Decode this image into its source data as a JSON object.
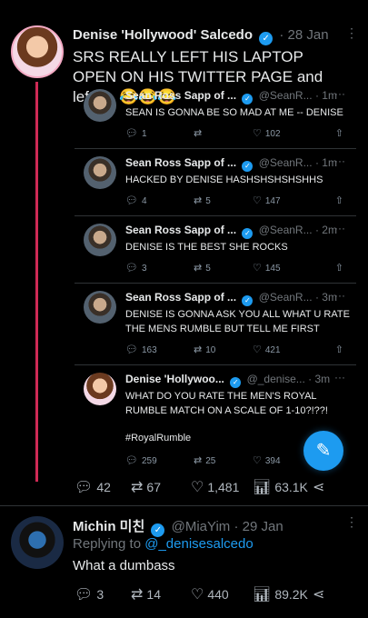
{
  "main_tweet": {
    "name": "Denise 'Hollywood' Salcedo",
    "time": "· 28 Jan",
    "text": "SRS REALLY LEFT HIS LAPTOP OPEN ON HIS TWITTER PAGE and left .... 😂😂😂",
    "stats": {
      "replies": "42",
      "retweets": "67",
      "likes": "1,481",
      "views": "63.1K"
    }
  },
  "quoted": [
    {
      "name": "Sean Ross Sapp of ...",
      "handle": "@SeanR...",
      "time": "· 1m",
      "text": "SEAN IS GONNA BE SO MAD AT ME -- DENISE",
      "replies": "1",
      "retweets": "",
      "likes": "102"
    },
    {
      "name": "Sean Ross Sapp of ...",
      "handle": "@SeanR...",
      "time": "· 1m",
      "text": "HACKED  BY DENISE HASHSHSHSHSHHS",
      "replies": "4",
      "retweets": "5",
      "likes": "147"
    },
    {
      "name": "Sean Ross Sapp of ...",
      "handle": "@SeanR...",
      "time": "· 2m",
      "text": "DENISE IS THE BEST SHE ROCKS",
      "replies": "3",
      "retweets": "5",
      "likes": "145"
    },
    {
      "name": "Sean Ross Sapp of ...",
      "handle": "@SeanR...",
      "time": "· 3m",
      "text": "DENISE IS GONNA ASK YOU ALL WHAT U RATE THE MENS RUMBLE BUT TELL ME FIRST",
      "replies": "163",
      "retweets": "10",
      "likes": "421"
    },
    {
      "name": "Denise 'Hollywoo...",
      "handle": "@_denise...",
      "time": "· 3m",
      "text": "WHAT DO YOU RATE THE MEN'S ROYAL RUMBLE MATCH ON A SCALE OF 1-10?!??!",
      "hashtag": "#RoyalRumble",
      "replies": "259",
      "retweets": "25",
      "likes": "394"
    }
  ],
  "reply_tweet": {
    "name": "Michin 미친",
    "handle": "@MiaYim",
    "time": "· 29 Jan",
    "replying_label": "Replying to",
    "replying_handle": "@_denisesalcedo",
    "text": "What a dumbass",
    "stats": {
      "replies": "3",
      "retweets": "14",
      "likes": "440",
      "views": "89.2K"
    }
  },
  "colors": {
    "accent": "#1d9bf0",
    "thread": "#cf2a55",
    "muted": "#71767b",
    "bg": "#000000"
  },
  "icons": [
    "verified-badge-icon",
    "more-dots-icon",
    "reply-icon",
    "retweet-icon",
    "like-icon",
    "views-icon",
    "share-icon",
    "compose-feather-icon"
  ]
}
